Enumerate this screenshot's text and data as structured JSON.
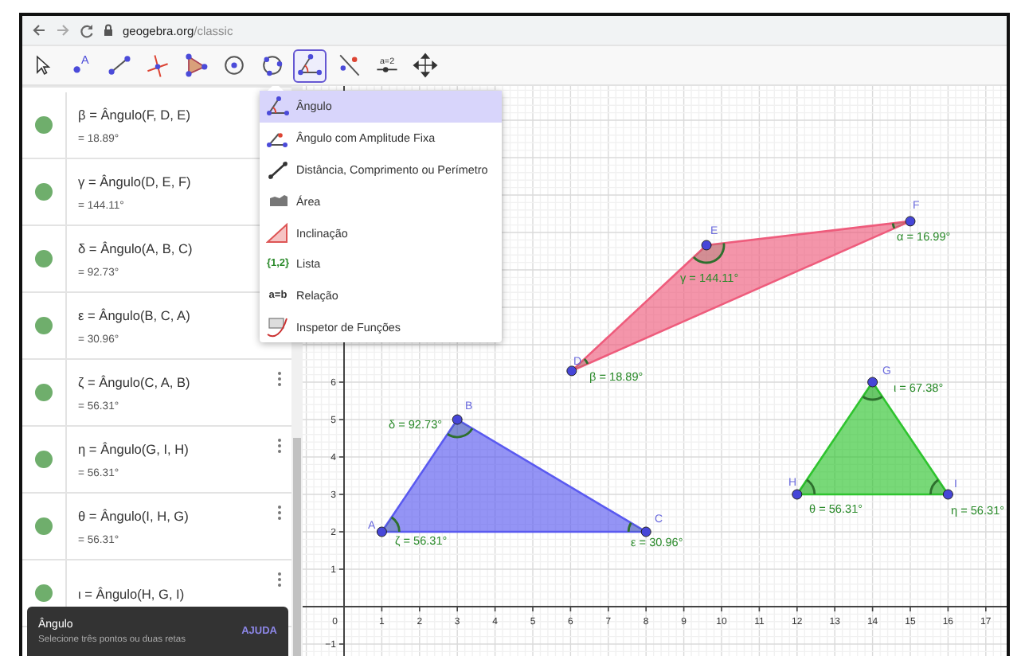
{
  "browser": {
    "url_host": "geogebra.org",
    "url_path": "/classic"
  },
  "toolbar": {
    "tools": [
      {
        "selected": false
      },
      {
        "selected": false,
        "icon_text": "A"
      },
      {
        "selected": false
      },
      {
        "selected": false
      },
      {
        "selected": false
      },
      {
        "selected": false
      },
      {
        "selected": false
      },
      {
        "selected": true
      },
      {
        "selected": false
      },
      {
        "selected": false,
        "icon_text": "a=2"
      },
      {
        "selected": false
      }
    ]
  },
  "algebra": {
    "rows": [
      {
        "definition": "β = Ângulo(F, D, E)",
        "value": "= 18.89°",
        "visible": true
      },
      {
        "definition": "γ = Ângulo(D, E, F)",
        "value": "= 144.11°",
        "visible": true
      },
      {
        "definition": "δ = Ângulo(A, B, C)",
        "value": "= 92.73°",
        "visible": true
      },
      {
        "definition": "ε = Ângulo(B, C, A)",
        "value": "= 30.96°",
        "visible": true
      },
      {
        "definition": "ζ = Ângulo(C, A, B)",
        "value": "= 56.31°",
        "visible": true
      },
      {
        "definition": "η = Ângulo(G, I, H)",
        "value": "= 56.31°",
        "visible": true
      },
      {
        "definition": "θ = Ângulo(I, H, G)",
        "value": "= 56.31°",
        "visible": true
      },
      {
        "definition": "ι = Ângulo(H, G, I)",
        "visible": true
      }
    ]
  },
  "tool_menu": {
    "items": [
      {
        "label": "Ângulo",
        "selected": true
      },
      {
        "label": "Ângulo com Amplitude Fixa",
        "selected": false
      },
      {
        "label": "Distância, Comprimento ou Perímetro",
        "selected": false
      },
      {
        "label": "Área",
        "selected": false
      },
      {
        "label": "Inclinação",
        "selected": false
      },
      {
        "label": "Lista",
        "selected": false,
        "icon_text": "{1,2}"
      },
      {
        "label": "Relação",
        "selected": false,
        "icon_text": "a=b"
      },
      {
        "label": "Inspetor de Funções",
        "selected": false
      }
    ]
  },
  "graphics": {
    "polygons": [
      {
        "color": "#ee5c7c"
      },
      {
        "color": "#5a5af0"
      },
      {
        "color": "#2fc42f"
      }
    ],
    "points": [
      {
        "label": "A"
      },
      {
        "label": "B"
      },
      {
        "label": "C"
      },
      {
        "label": "D"
      },
      {
        "label": "E"
      },
      {
        "label": "F"
      },
      {
        "label": "G"
      },
      {
        "label": "H"
      },
      {
        "label": "I"
      }
    ],
    "angles": [
      {
        "label": "α = 16.99°"
      },
      {
        "label": "β = 18.89°"
      },
      {
        "label": "γ = 144.11°"
      },
      {
        "label": "δ = 92.73°"
      },
      {
        "label": "ε = 30.96°"
      },
      {
        "label": "ζ = 56.31°"
      },
      {
        "label": "η = 56.31°"
      },
      {
        "label": "θ = 56.31°"
      },
      {
        "label": "ι = 67.38°"
      }
    ],
    "x_ticks": [
      "0",
      "1",
      "2",
      "3",
      "4",
      "5",
      "6",
      "7",
      "8",
      "9",
      "10",
      "11",
      "12",
      "13",
      "14",
      "15",
      "16",
      "17"
    ],
    "y_ticks": [
      "6",
      "5",
      "4",
      "3",
      "2",
      "1",
      "−1"
    ]
  },
  "toast": {
    "title": "Ângulo",
    "message": "Selecione três pontos ou duas retas",
    "action": "AJUDA"
  }
}
